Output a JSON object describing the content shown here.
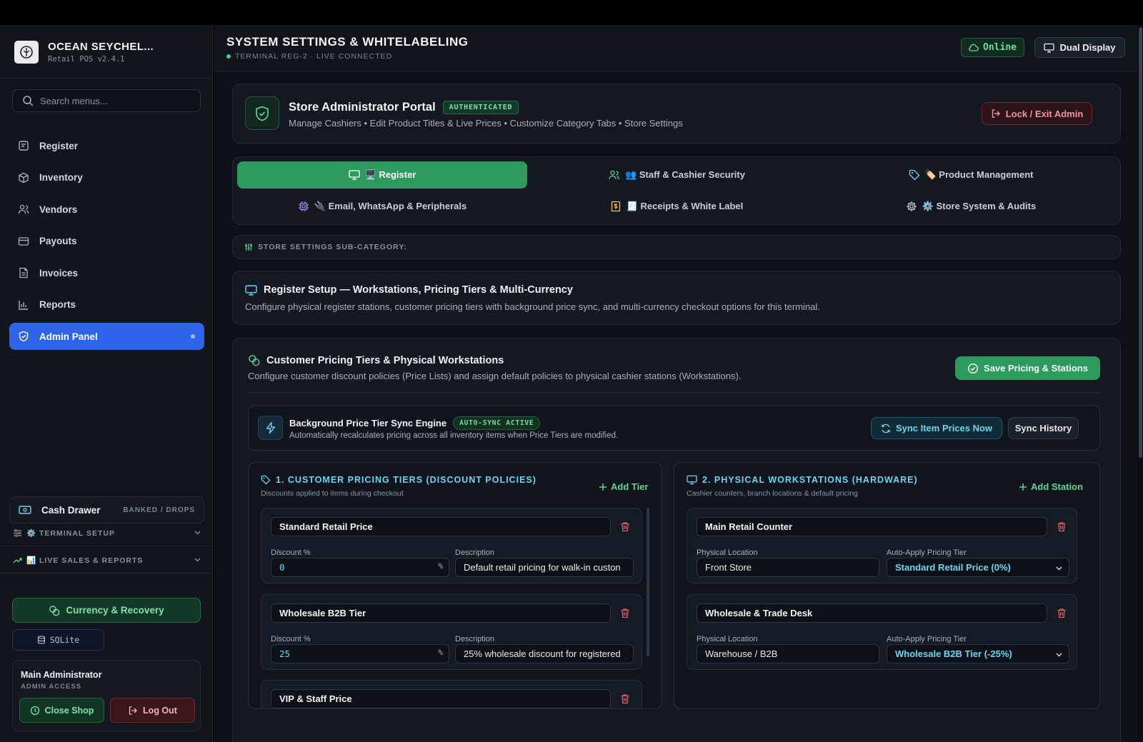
{
  "brand": {
    "name": "OCEAN SEYCHEL...",
    "version": "Retail POS v2.4.1"
  },
  "search": {
    "placeholder": "Search menus..."
  },
  "nav": [
    {
      "label": "Register",
      "icon": "register-icon"
    },
    {
      "label": "Inventory",
      "icon": "box-icon"
    },
    {
      "label": "Vendors",
      "icon": "users-icon"
    },
    {
      "label": "Payouts",
      "icon": "card-icon"
    },
    {
      "label": "Invoices",
      "icon": "file-icon"
    },
    {
      "label": "Reports",
      "icon": "chart-icon"
    },
    {
      "label": "Admin Panel",
      "icon": "shield-icon",
      "active": true
    }
  ],
  "cash_drawer": {
    "label": "Cash Drawer",
    "sub": "BANKED / DROPS"
  },
  "sections": {
    "terminal": "⚙️ TERMINAL SETUP",
    "live": "📊 LIVE SALES & REPORTS"
  },
  "currency_button": "Currency & Recovery",
  "db_badge": "SQLite",
  "user": {
    "name": "Main Administrator",
    "role": "ADMIN ACCESS",
    "close_label": "Close Shop",
    "logout_label": "Log Out"
  },
  "header": {
    "title": "SYSTEM SETTINGS & WHITELABELING",
    "subtitle": "TERMINAL REG-2 · LIVE CONNECTED",
    "online_label": "Online",
    "dual_label": "Dual Display"
  },
  "portal": {
    "title": "Store Administrator Portal",
    "badge": "AUTHENTICATED",
    "desc": "Manage Cashiers • Edit Product Titles & Live Prices • Customize Category Tabs • Store Settings",
    "lock_label": "Lock / Exit Admin"
  },
  "tabs": [
    {
      "label": "🖥️ Register",
      "icon": "monitor-icon",
      "active": true
    },
    {
      "label": "👥 Staff & Cashier Security",
      "icon": "users-icon"
    },
    {
      "label": "🏷️ Product Management",
      "icon": "tag-icon"
    },
    {
      "label": "🔌 Email, WhatsApp & Peripherals",
      "icon": "chip-icon"
    },
    {
      "label": "🧾 Receipts & White Label",
      "icon": "receipt-icon"
    },
    {
      "label": "⚙️ Store System & Audits",
      "icon": "gear-icon"
    }
  ],
  "subcategory_label": "STORE SETTINGS SUB-CATEGORY:",
  "register_setup": {
    "title": "Register Setup — Workstations, Pricing Tiers & Multi-Currency",
    "desc": "Configure physical register stations, customer pricing tiers with background price sync, and multi-currency checkout options for this terminal."
  },
  "pricing": {
    "title": "Customer Pricing Tiers & Physical Workstations",
    "desc": "Configure customer discount policies (Price Lists) and assign default policies to physical cashier stations (Workstations).",
    "save_label": "Save Pricing & Stations",
    "sync": {
      "title": "Background Price Tier Sync Engine",
      "badge": "AUTO-SYNC ACTIVE",
      "desc": "Automatically recalculates pricing across all inventory items when Price Tiers are modified.",
      "sync_now_label": "Sync Item Prices Now",
      "history_label": "Sync History"
    },
    "tiers_col": {
      "title": "1. CUSTOMER PRICING TIERS (DISCOUNT POLICIES)",
      "sub": "Discounts applied to items during checkout",
      "add_label": "Add Tier",
      "discount_label": "Discount %",
      "desc_label": "Description",
      "pct_symbol": "%",
      "items": [
        {
          "name": "Standard Retail Price",
          "discount": "0",
          "description": "Default retail pricing for walk-in custon"
        },
        {
          "name": "Wholesale B2B Tier",
          "discount": "25",
          "description": "25% wholesale discount for registered"
        },
        {
          "name": "VIP & Staff Price"
        }
      ]
    },
    "stations_col": {
      "title": "2. PHYSICAL WORKSTATIONS (HARDWARE)",
      "sub": "Cashier counters, branch locations & default pricing",
      "add_label": "Add Station",
      "location_label": "Physical Location",
      "tier_label": "Auto-Apply Pricing Tier",
      "items": [
        {
          "name": "Main Retail Counter",
          "location": "Front Store",
          "tier": "Standard Retail Price (0%)"
        },
        {
          "name": "Wholesale & Trade Desk",
          "location": "Warehouse / B2B",
          "tier": "Wholesale B2B Tier (-25%)"
        }
      ]
    }
  }
}
